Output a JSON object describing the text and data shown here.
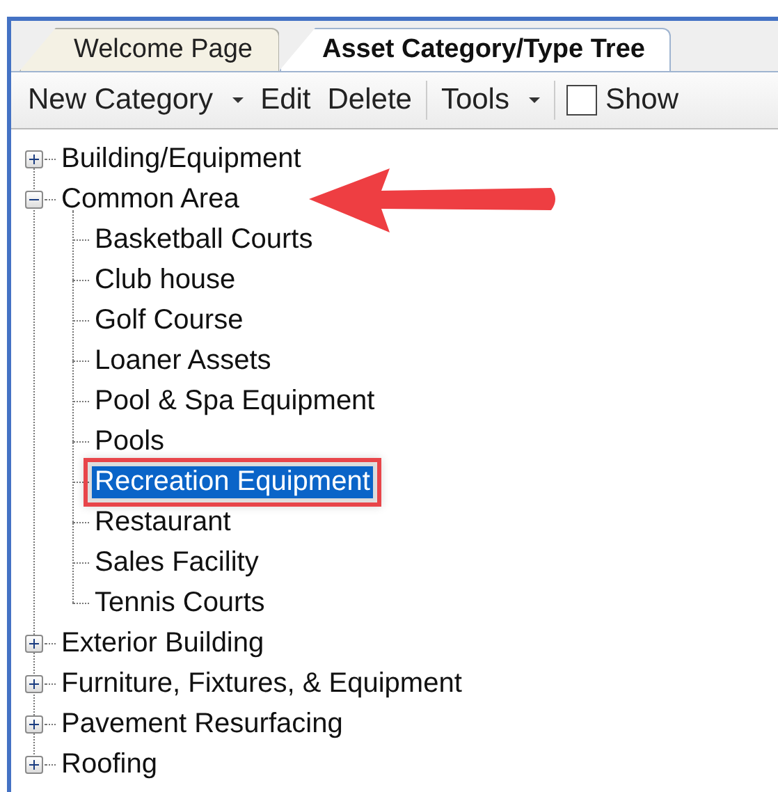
{
  "tabs": [
    {
      "label": "Welcome Page",
      "selected": false
    },
    {
      "label": "Asset Category/Type Tree",
      "selected": true
    }
  ],
  "toolbar": [
    {
      "kind": "dropdown",
      "label": "New Category"
    },
    {
      "kind": "button",
      "label": "Edit"
    },
    {
      "kind": "button",
      "label": "Delete"
    },
    {
      "kind": "separator"
    },
    {
      "kind": "dropdown",
      "label": "Tools"
    },
    {
      "kind": "separator"
    },
    {
      "kind": "checkbox",
      "label": "Show",
      "checked": false
    }
  ],
  "tree": [
    {
      "label": "Building/Equipment",
      "expanded": false
    },
    {
      "label": "Common Area",
      "expanded": true,
      "annotated": true,
      "children": [
        {
          "label": "Basketball Courts",
          "selected": false
        },
        {
          "label": "Club house",
          "selected": false
        },
        {
          "label": "Golf Course",
          "selected": false
        },
        {
          "label": "Loaner Assets",
          "selected": false
        },
        {
          "label": "Pool & Spa Equipment",
          "selected": false
        },
        {
          "label": "Pools",
          "selected": false
        },
        {
          "label": "Recreation Equipment",
          "selected": true
        },
        {
          "label": "Restaurant",
          "selected": false
        },
        {
          "label": "Sales Facility",
          "selected": false
        },
        {
          "label": "Tennis Courts",
          "selected": false
        }
      ]
    },
    {
      "label": "Exterior Building",
      "expanded": false
    },
    {
      "label": "Furniture, Fixtures, & Equipment",
      "expanded": false
    },
    {
      "label": "Pavement Resurfacing",
      "expanded": false
    },
    {
      "label": "Roofing",
      "expanded": false
    }
  ]
}
